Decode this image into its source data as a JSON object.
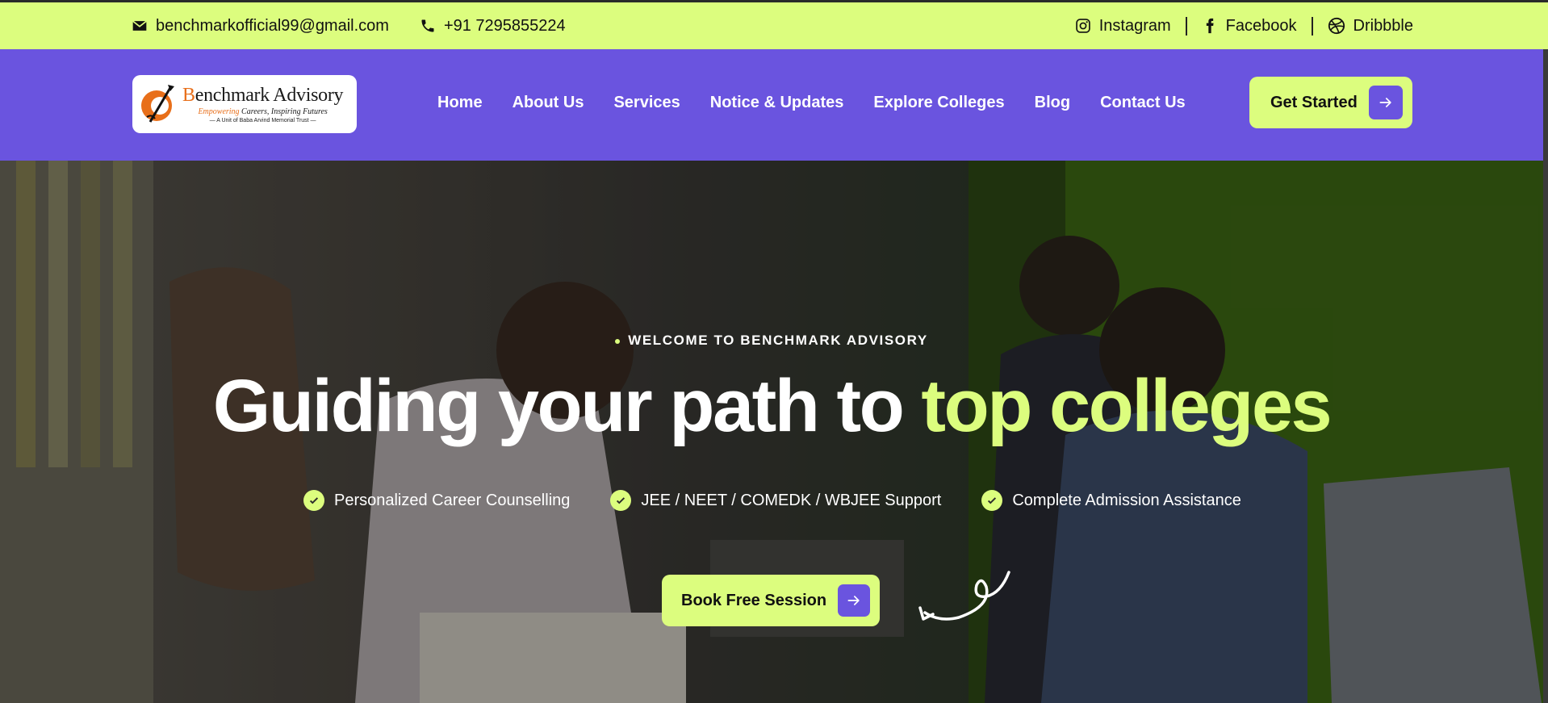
{
  "topbar": {
    "email": "benchmarkofficial99@gmail.com",
    "phone": "+91 7295855224",
    "socials": [
      {
        "label": "Instagram",
        "icon": "instagram-icon"
      },
      {
        "label": "Facebook",
        "icon": "facebook-icon"
      },
      {
        "label": "Dribbble",
        "icon": "dribbble-icon"
      }
    ]
  },
  "logo": {
    "title_initial": "B",
    "title_rest": "enchmark Advisory",
    "tagline_accent": "Empowering",
    "tagline_rest": " Careers, Inspiring Futures",
    "subtext": "— A Unit of Baba Arvind Memorial Trust —"
  },
  "nav": {
    "items": [
      "Home",
      "About Us",
      "Services",
      "Notice & Updates",
      "Explore Colleges",
      "Blog",
      "Contact Us"
    ],
    "cta_label": "Get Started"
  },
  "hero": {
    "eyebrow": "WELCOME TO BENCHMARK ADVISORY",
    "headline_main": "Guiding your path to ",
    "headline_accent": "top colleges",
    "features": [
      "Personalized Career Counselling",
      "JEE / NEET / COMEDK / WBJEE Support",
      "Complete Admission Assistance"
    ],
    "cta_label": "Book Free Session"
  },
  "colors": {
    "accent_lime": "#dcfd7e",
    "brand_purple": "#6a54df",
    "logo_orange": "#e86f1a"
  }
}
